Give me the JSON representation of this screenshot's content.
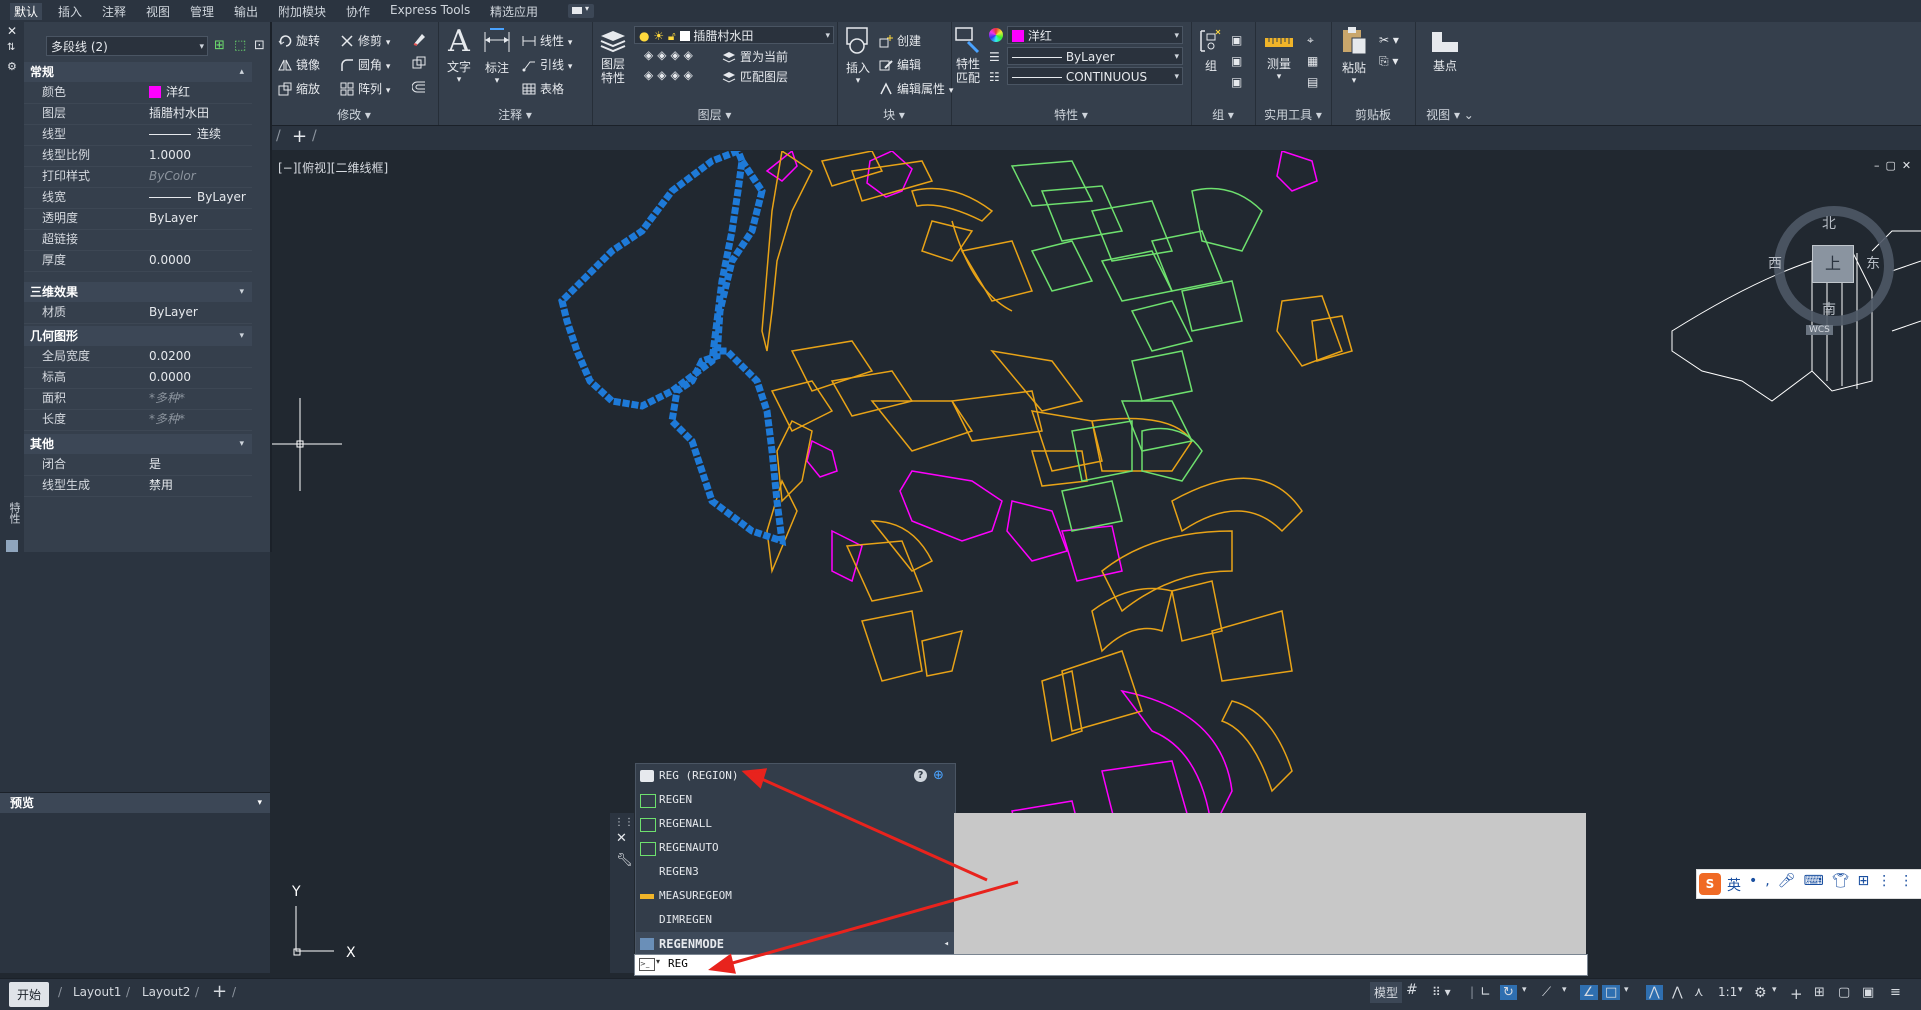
{
  "menu": {
    "tabs": [
      "默认",
      "插入",
      "注释",
      "视图",
      "管理",
      "输出",
      "附加模块",
      "协作",
      "Express Tools",
      "精选应用"
    ]
  },
  "ribbon": {
    "modify": {
      "title": "修改",
      "rotate": "旋转",
      "trim": "修剪",
      "mirror": "镜像",
      "fillet": "圆角",
      "scale": "缩放",
      "array": "阵列"
    },
    "annotation": {
      "title": "注释",
      "text": "文字",
      "dimension": "标注",
      "linear": "线性",
      "leader": "引线",
      "table": "表格"
    },
    "layers": {
      "title": "图层",
      "layer_props": "图层特性",
      "current_layer": "插腊村水田",
      "set_current": "置为当前",
      "match_layer": "匹配图层"
    },
    "block": {
      "title": "块",
      "insert": "插入",
      "create": "创建",
      "edit": "编辑",
      "edit_attr": "编辑属性"
    },
    "properties": {
      "title": "特性",
      "match": "特性匹配",
      "color": "洋红",
      "lineweight": "ByLayer",
      "linetype": "CONTINUOUS"
    },
    "groups": {
      "title": "组",
      "group": "组"
    },
    "utilities": {
      "title": "实用工具",
      "measure": "测量"
    },
    "clipboard": {
      "title": "剪贴板",
      "paste": "粘贴"
    },
    "view": {
      "title": "视图",
      "basepoint": "基点"
    }
  },
  "properties_palette": {
    "selector": "多段线 (2)",
    "side_label": "特性",
    "sections": {
      "general": "常规",
      "3d": "三维效果",
      "geometry": "几何图形",
      "misc": "其他"
    },
    "general_rows": [
      {
        "name": "颜色",
        "value": "洋红"
      },
      {
        "name": "图层",
        "value": "插腊村水田"
      },
      {
        "name": "线型",
        "value": "连续"
      },
      {
        "name": "线型比例",
        "value": "1.0000"
      },
      {
        "name": "打印样式",
        "value": "ByColor"
      },
      {
        "name": "线宽",
        "value": "ByLayer"
      },
      {
        "name": "透明度",
        "value": "ByLayer"
      },
      {
        "name": "超链接",
        "value": ""
      },
      {
        "name": "厚度",
        "value": "0.0000"
      }
    ],
    "3d_rows": [
      {
        "name": "材质",
        "value": "ByLayer"
      }
    ],
    "geometry_rows": [
      {
        "name": "全局宽度",
        "value": "0.0200"
      },
      {
        "name": "标高",
        "value": "0.0000"
      },
      {
        "name": "面积",
        "value": "*多种*"
      },
      {
        "name": "长度",
        "value": "*多种*"
      }
    ],
    "misc_rows": [
      {
        "name": "闭合",
        "value": "是"
      },
      {
        "name": "线型生成",
        "value": "禁用"
      }
    ]
  },
  "preview": {
    "title": "预览"
  },
  "viewport": {
    "label": "[−][俯视][二维线框]",
    "compass": {
      "north": "北",
      "south": "南",
      "east": "东",
      "west": "西",
      "top": "上",
      "wcs": "WCS"
    },
    "ucs_x": "X",
    "ucs_y": "Y"
  },
  "autocomplete": {
    "items": [
      "REG (REGION)",
      "REGEN",
      "REGENALL",
      "REGENAUTO",
      "REGEN3",
      "MEASUREGEOM",
      "DIMREGEN",
      "REGENMODE"
    ],
    "input": "REG"
  },
  "statusbar": {
    "start": "开始",
    "layouts": [
      "Layout1",
      "Layout2"
    ],
    "model": "模型",
    "scale": "1:1"
  },
  "ime": {
    "mode": "英"
  },
  "colors": {
    "magenta": "#ff00ff",
    "yellow": "#e8a317",
    "green": "#6ee06e",
    "blue": "#1e7ad8",
    "white": "#ffffff",
    "red": "#e8231d"
  }
}
